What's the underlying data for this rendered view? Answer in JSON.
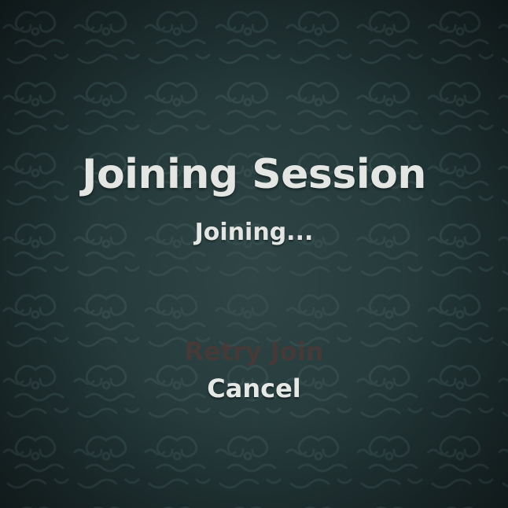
{
  "dialog": {
    "title": "Joining Session",
    "status": "Joining...",
    "retry_label": "Retry Join",
    "retry_enabled": false,
    "cancel_label": "Cancel"
  },
  "theme": {
    "background": "#253a3b",
    "pattern_color": "#3d5556",
    "text_color": "#e4e6e3",
    "disabled_text_color": "#4a3a36"
  }
}
